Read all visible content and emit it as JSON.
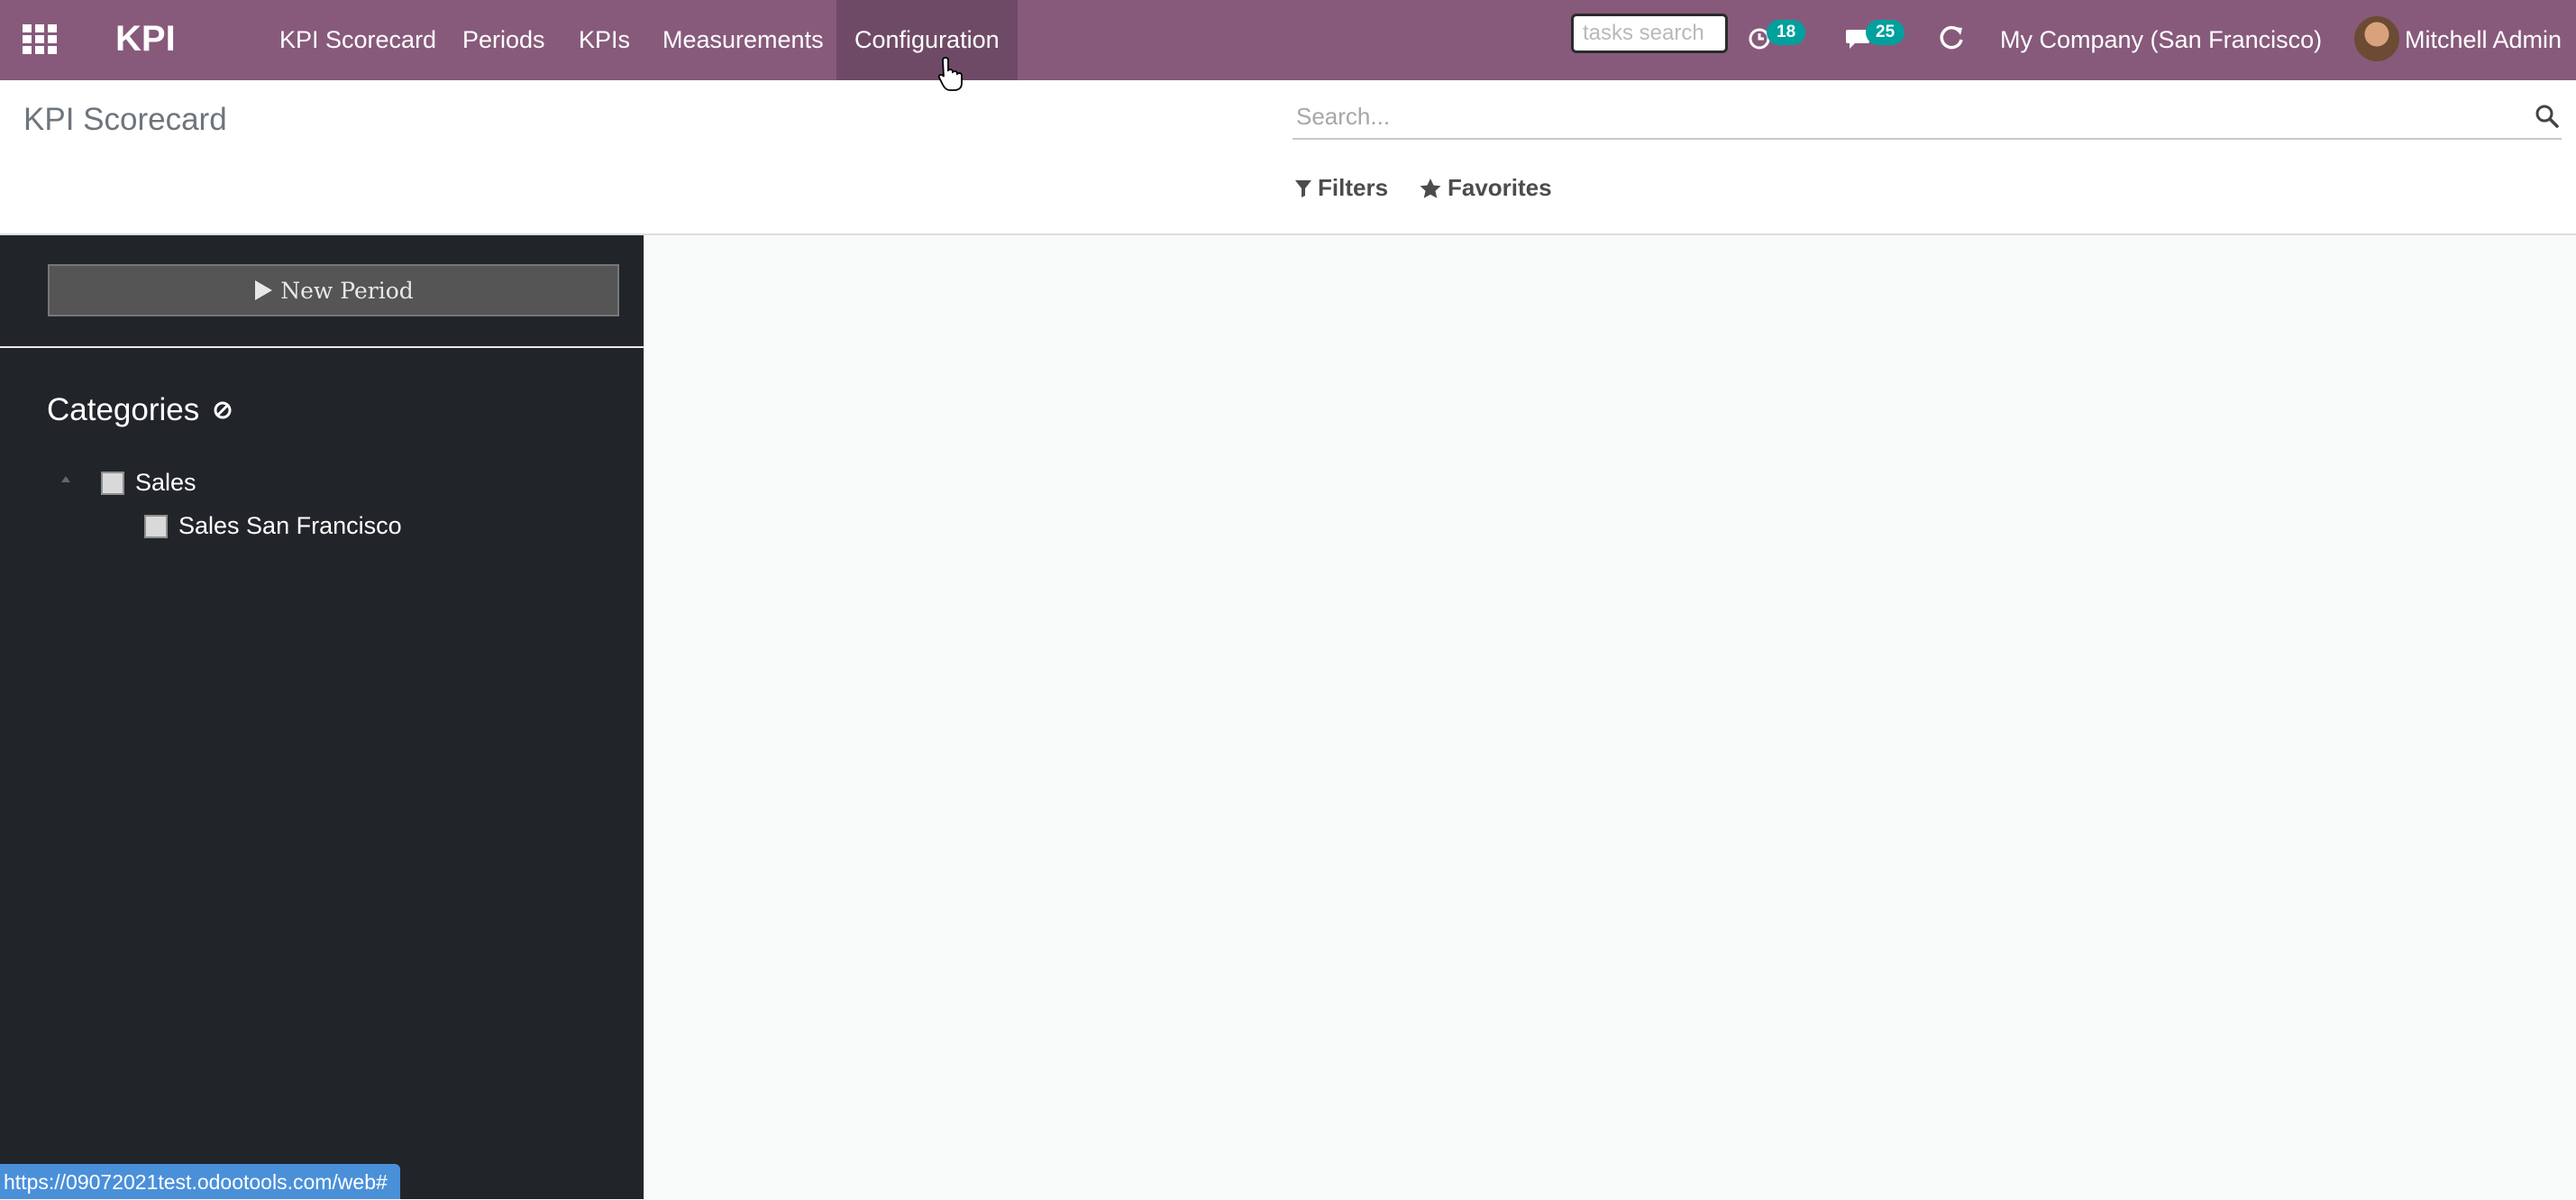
{
  "navbar": {
    "brand": "KPI",
    "menu": [
      "KPI Scorecard",
      "Periods",
      "KPIs",
      "Measurements",
      "Configuration"
    ],
    "tasks_search_placeholder": "tasks search",
    "activity_count": "18",
    "messages_count": "25",
    "company": "My Company (San Francisco)",
    "user": "Mitchell Admin",
    "icons": [
      "apps-grid-icon",
      "clock-icon",
      "chat-icon",
      "refresh-icon",
      "avatar"
    ]
  },
  "control_panel": {
    "title": "KPI Scorecard",
    "search_placeholder": "Search...",
    "filters_label": "Filters",
    "favorites_label": "Favorites"
  },
  "sidebar": {
    "new_period_label": "New Period",
    "categories_title": "Categories",
    "categories": [
      {
        "label": "Sales",
        "checked": false
      },
      {
        "label": "Sales San Francisco",
        "checked": false
      }
    ]
  },
  "status_url": "https://09072021test.odootools.com/web#",
  "colors": {
    "navbar": "#875a7b",
    "navbar_active": "#6f4a66",
    "badge": "#00a09d",
    "sidebar": "#212529",
    "content_bg": "#f8f9f9",
    "status_bar": "#4a90d9"
  }
}
